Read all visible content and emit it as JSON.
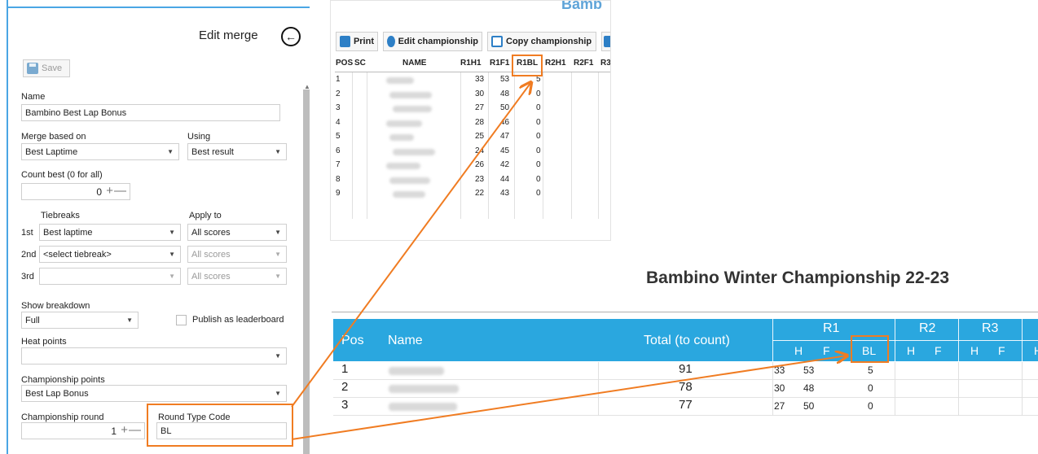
{
  "edit_merge": {
    "title": "Edit merge",
    "save_label": "Save",
    "name_label": "Name",
    "name_value": "Bambino Best Lap Bonus",
    "merge_based_on_label": "Merge based on",
    "merge_based_on_value": "Best Laptime",
    "using_label": "Using",
    "using_value": "Best result",
    "count_best_label": "Count best (0 for all)",
    "count_best_value": "0",
    "tiebreaks_label": "Tiebreaks",
    "apply_to_label": "Apply to",
    "tiebreaks": [
      {
        "ordinal": "1st",
        "tiebreak": "Best laptime",
        "apply": "All scores"
      },
      {
        "ordinal": "2nd",
        "tiebreak": "<select tiebreak>",
        "apply": "All scores"
      },
      {
        "ordinal": "3rd",
        "tiebreak": "",
        "apply": "All scores"
      }
    ],
    "show_breakdown_label": "Show breakdown",
    "show_breakdown_value": "Full",
    "publish_label": "Publish as leaderboard",
    "heat_points_label": "Heat points",
    "heat_points_value": "",
    "championship_points_label": "Championship points",
    "championship_points_value": "Best Lap Bonus",
    "championship_round_label": "Championship round",
    "championship_round_value": "1",
    "round_type_code_label": "Round Type Code",
    "round_type_code_value": "BL"
  },
  "grid": {
    "heading_fragment": "Bamb",
    "toolbar": [
      "Print",
      "Edit championship",
      "Copy championship"
    ],
    "columns": [
      "POS",
      "SC",
      "NAME",
      "R1H1",
      "R1F1",
      "R1BL",
      "R2H1",
      "R2F1",
      "R3"
    ],
    "rows": [
      {
        "pos": "1",
        "h1": "33",
        "f1": "53",
        "bl": "5"
      },
      {
        "pos": "2",
        "h1": "30",
        "f1": "48",
        "bl": "0"
      },
      {
        "pos": "3",
        "h1": "27",
        "f1": "50",
        "bl": "0"
      },
      {
        "pos": "4",
        "h1": "28",
        "f1": "46",
        "bl": "0"
      },
      {
        "pos": "5",
        "h1": "25",
        "f1": "47",
        "bl": "0"
      },
      {
        "pos": "6",
        "h1": "24",
        "f1": "45",
        "bl": "0"
      },
      {
        "pos": "7",
        "h1": "26",
        "f1": "42",
        "bl": "0"
      },
      {
        "pos": "8",
        "h1": "23",
        "f1": "44",
        "bl": "0"
      },
      {
        "pos": "9",
        "h1": "22",
        "f1": "43",
        "bl": "0"
      }
    ]
  },
  "championship": {
    "title": "Bambino Winter Championship 22-23",
    "col_pos": "Pos",
    "col_name": "Name",
    "col_total": "Total (to count)",
    "rounds": [
      "R1",
      "R2",
      "R3"
    ],
    "r1_sub": [
      "H",
      "F",
      "BL"
    ],
    "r2_sub": [
      "H",
      "F"
    ],
    "r3_sub": [
      "H",
      "F"
    ],
    "extra_sub": "H",
    "rows": [
      {
        "pos": "1",
        "total": "91",
        "h": "33",
        "f": "53",
        "bl": "5"
      },
      {
        "pos": "2",
        "total": "78",
        "h": "30",
        "f": "48",
        "bl": "0"
      },
      {
        "pos": "3",
        "total": "77",
        "h": "27",
        "f": "50",
        "bl": "0"
      }
    ]
  },
  "colors": {
    "accent_orange": "#f07c22",
    "header_blue": "#2aa7df",
    "link_blue": "#2d7fc6"
  }
}
